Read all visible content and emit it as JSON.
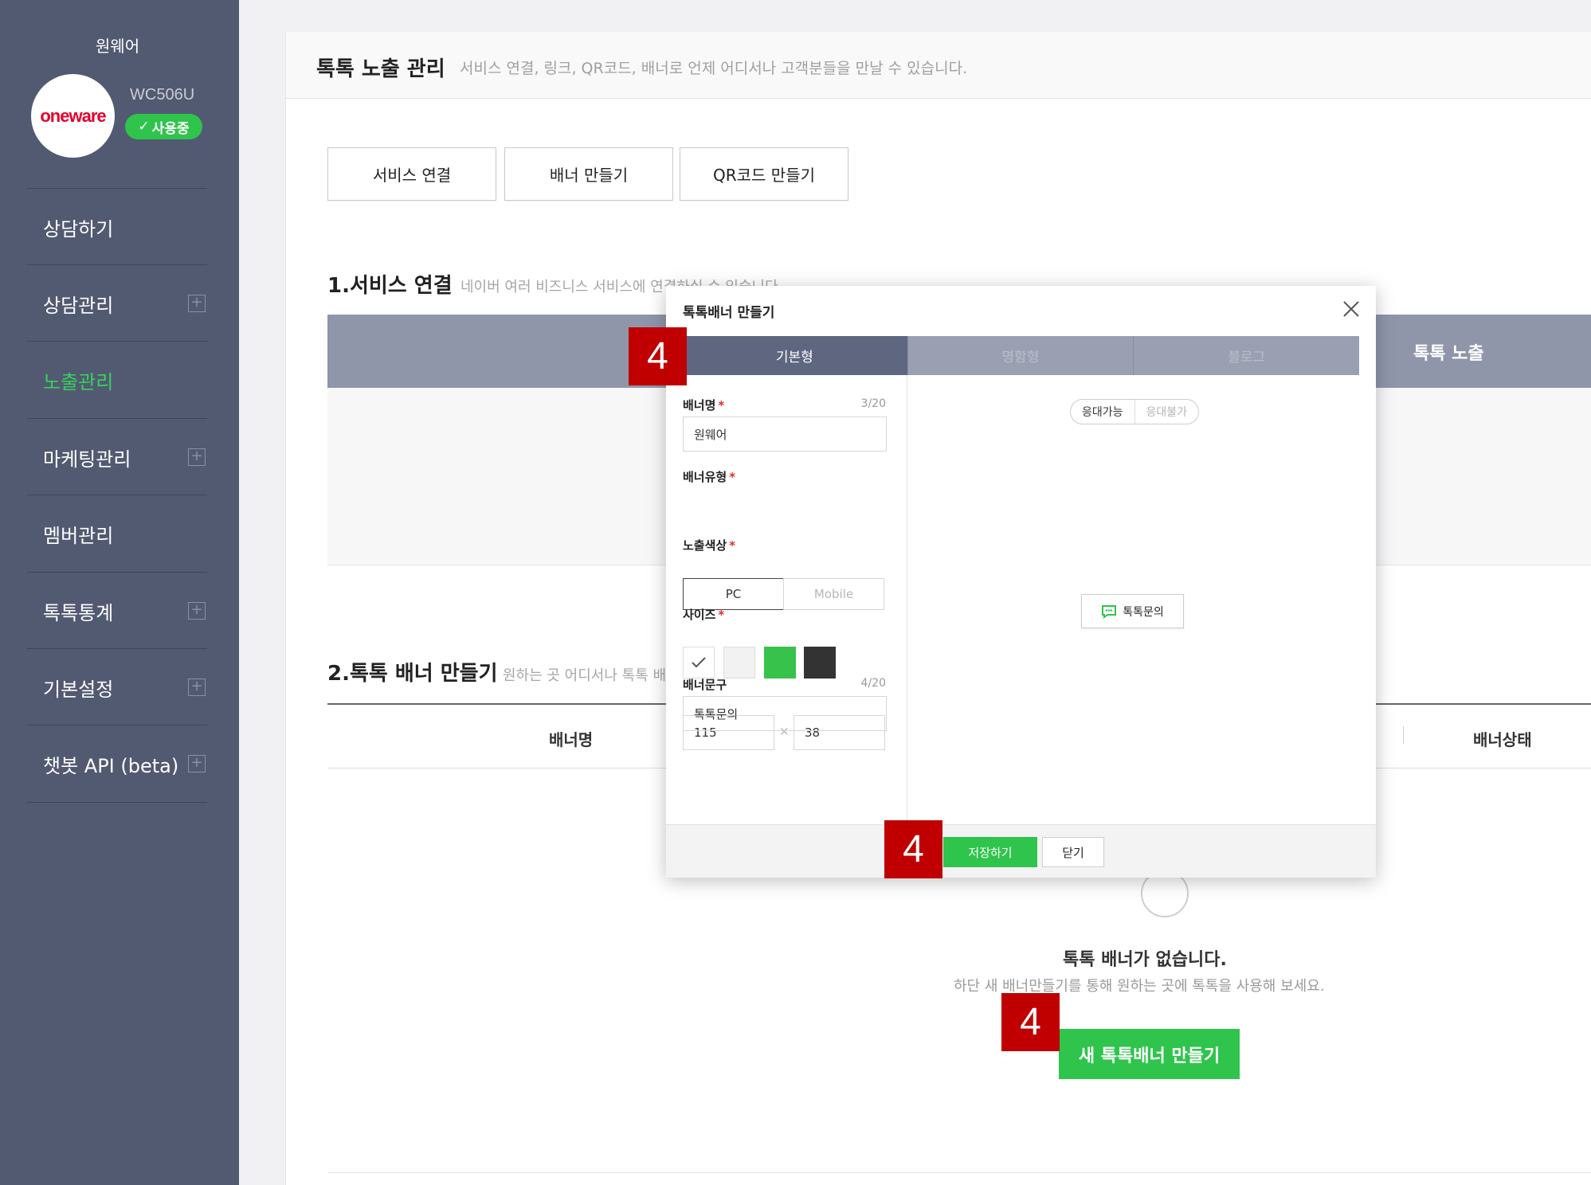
{
  "sidebar": {
    "account_name": "원웨어",
    "logo_text": "oneware",
    "account_id": "WC506U",
    "status_badge": "사용중",
    "items": [
      {
        "label": "상담하기"
      },
      {
        "label": "상담관리"
      },
      {
        "label": "노출관리"
      },
      {
        "label": "마케팅관리"
      },
      {
        "label": "멤버관리"
      },
      {
        "label": "톡톡통계"
      },
      {
        "label": "기본설정"
      },
      {
        "label": "챗봇 API (beta)"
      }
    ],
    "plus_glyph": "+"
  },
  "header": {
    "title": "톡톡 노출 관리",
    "subtitle": "서비스 연결, 링크, QR코드, 배너로 언제 어디서나 고객분들을 만날 수 있습니다."
  },
  "tabs": {
    "service_link": "서비스 연결",
    "make_banner": "배너 만들기",
    "make_qr": "QR코드 만들기"
  },
  "section1": {
    "title": "1.서비스 연결",
    "subtitle": "네이버 여러 비즈니스 서비스에 연결하실 수 있습니다",
    "col_exposure": "톡톡 노출"
  },
  "section2": {
    "title": "2.톡톡 배너 만들기",
    "subtitle": "원하는 곳 어디서나 톡톡 배",
    "col_banner_name": "배너명",
    "col_banner_status": "배너상태",
    "empty_title": "톡톡 배너가 없습니다.",
    "empty_desc": "하단 새 배너만들기를 통해 원하는 곳에 톡톡을 사용해 보세요.",
    "new_banner_button": "새 톡톡배너 만들기"
  },
  "modal": {
    "title": "톡톡배너 만들기",
    "tabs": [
      "기본형",
      "명함형",
      "블로그"
    ],
    "fields": {
      "name_label": "배너명",
      "name_count": "3/20",
      "name_value": "원웨어",
      "type_label": "배너유형",
      "type_pc": "PC",
      "type_mobile": "Mobile",
      "color_label": "노출색상",
      "size_label": "사이즈",
      "size_width": "115",
      "size_x": "×",
      "size_height": "38",
      "text_label": "배너문구",
      "text_count": "4/20",
      "text_value": "톡톡문의"
    },
    "required_mark": "*",
    "preview": {
      "toggle_available": "응대가능",
      "toggle_unavailable": "응대불가",
      "banner_text": "톡톡문의"
    },
    "save_button": "저장하기",
    "close_button": "닫기"
  },
  "step_markers": [
    "4",
    "4",
    "4"
  ],
  "colors": {
    "sidebar_bg": "#525a72",
    "accent_green": "#2fc44c",
    "active_nav": "#37d25a",
    "marker_red": "#c00000",
    "swatches": [
      "#ffffff",
      "#f2f2f2",
      "#37c24c",
      "#333333"
    ]
  }
}
